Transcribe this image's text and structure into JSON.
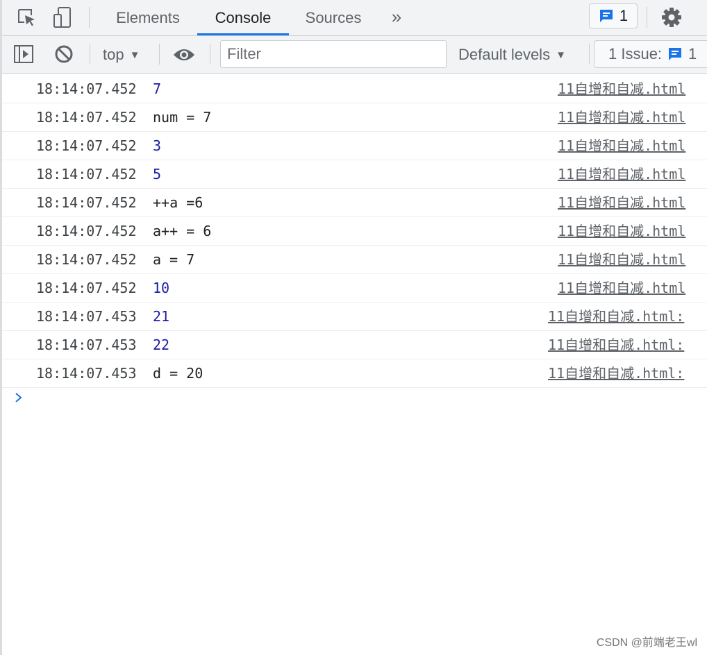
{
  "tabs": [
    {
      "label": "Elements"
    },
    {
      "label": "Console"
    },
    {
      "label": "Sources"
    }
  ],
  "more_tabs_glyph": "»",
  "message_badge_count": "1",
  "toolbar": {
    "context": "top",
    "filter_placeholder": "Filter",
    "levels_label": "Default levels",
    "issues_label": "1 Issue:",
    "issues_count": "1"
  },
  "logs": [
    {
      "time": "18:14:07.452",
      "message": "7",
      "kind": "number",
      "source": "11自增和自减.html"
    },
    {
      "time": "18:14:07.452",
      "message": "num = 7",
      "kind": "string",
      "source": "11自增和自减.html"
    },
    {
      "time": "18:14:07.452",
      "message": "3",
      "kind": "number",
      "source": "11自增和自减.html"
    },
    {
      "time": "18:14:07.452",
      "message": "5",
      "kind": "number",
      "source": "11自增和自减.html"
    },
    {
      "time": "18:14:07.452",
      "message": "++a =6",
      "kind": "string",
      "source": "11自增和自减.html"
    },
    {
      "time": "18:14:07.452",
      "message": "a++ = 6",
      "kind": "string",
      "source": "11自增和自减.html"
    },
    {
      "time": "18:14:07.452",
      "message": "a = 7",
      "kind": "string",
      "source": "11自增和自减.html"
    },
    {
      "time": "18:14:07.452",
      "message": "10",
      "kind": "number",
      "source": "11自增和自减.html"
    },
    {
      "time": "18:14:07.453",
      "message": "21",
      "kind": "number",
      "source": "11自增和自减.html:"
    },
    {
      "time": "18:14:07.453",
      "message": "22",
      "kind": "number",
      "source": "11自增和自减.html:"
    },
    {
      "time": "18:14:07.453",
      "message": "d = 20",
      "kind": "string",
      "source": "11自增和自减.html:"
    }
  ],
  "watermark": "CSDN @前端老王wl",
  "colors": {
    "accent": "#1a73e8",
    "number": "#1a1aa6",
    "toolbar_bg": "#f1f3f4"
  }
}
